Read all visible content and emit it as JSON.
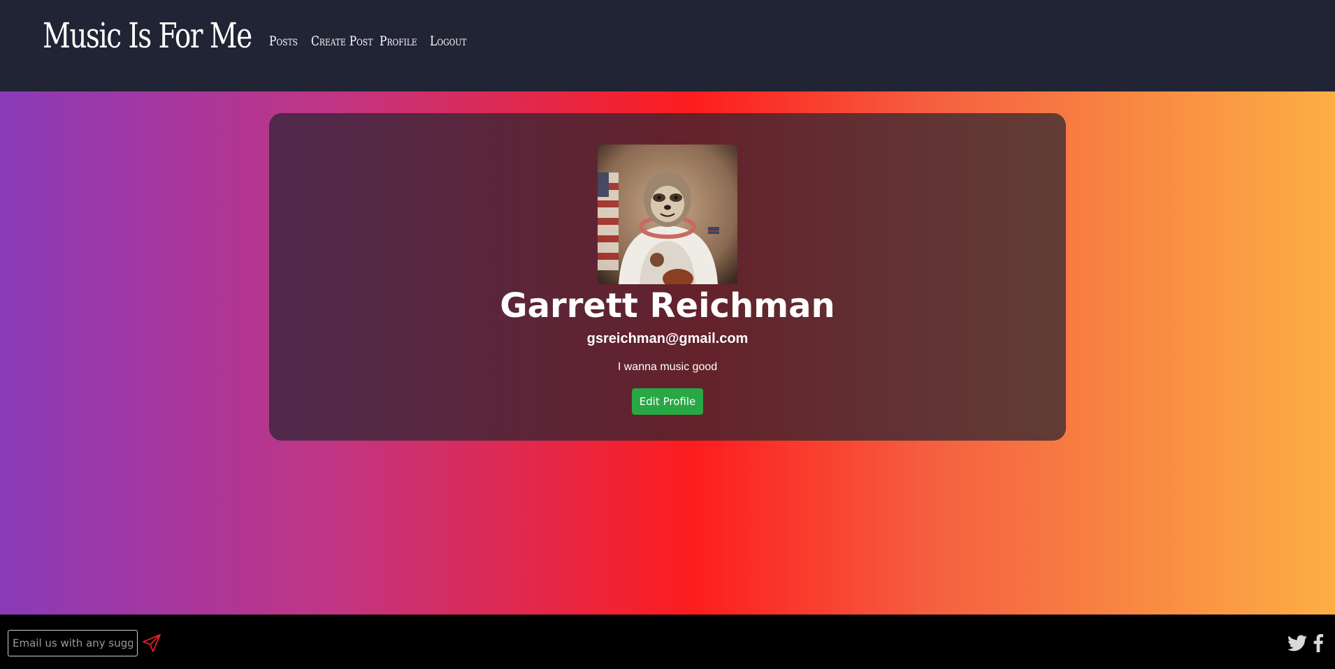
{
  "header": {
    "brand": "Music Is For Me",
    "nav": [
      {
        "label": "Posts"
      },
      {
        "label": "Create Post"
      },
      {
        "label": "Profile"
      },
      {
        "label": "Logout"
      }
    ]
  },
  "profile": {
    "avatar_icon": "sloth-astronaut-avatar",
    "name": "Garrett Reichman",
    "email": "gsreichman@gmail.com",
    "bio": "I wanna music good",
    "edit_label": "Edit Profile"
  },
  "footer": {
    "input_placeholder": "Email us with any suggestions",
    "send_icon": "send-icon",
    "social": [
      "twitter-icon",
      "facebook-icon"
    ]
  },
  "colors": {
    "navbar": "#212435",
    "footer": "#000000",
    "edit_button": "#28a745",
    "send_icon": "#e0202a",
    "gradient": [
      "#8a3ab9",
      "#c13584",
      "#fd1d1d",
      "#f56040",
      "#fcaf45"
    ]
  }
}
